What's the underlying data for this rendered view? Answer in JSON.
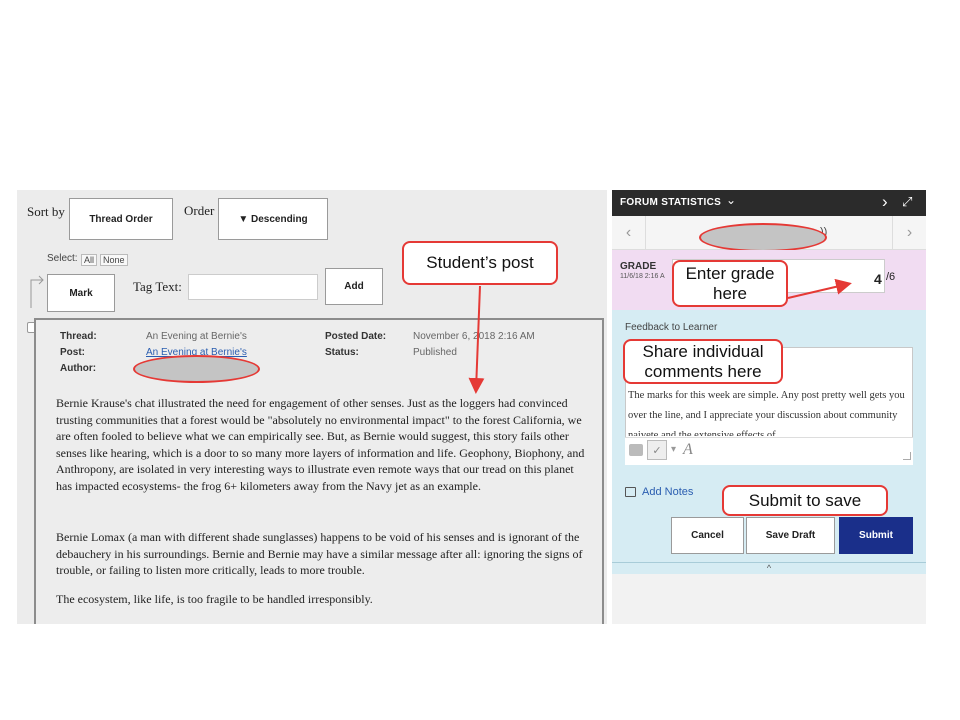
{
  "sort": {
    "sort_by_label": "Sort by",
    "sort_value": "Thread Order",
    "order_label": "Order",
    "order_value": "▼ Descending"
  },
  "select": {
    "label": "Select:",
    "all": "All",
    "none": "None"
  },
  "tagging": {
    "mark_button": "Mark",
    "tag_text_label": "Tag Text:",
    "tag_text_value": "",
    "add_button": "Add"
  },
  "post": {
    "thread_label": "Thread:",
    "thread_value": "An Evening at Bernie's",
    "post_label": "Post:",
    "post_value": "An Evening at Bernie's",
    "author_label": "Author:",
    "posted_date_label": "Posted Date:",
    "posted_date_value": "November 6, 2018 2:16 AM",
    "status_label": "Status:",
    "status_value": "Published",
    "paragraphs": [
      "Bernie Krause's chat illustrated the need for engagement of other senses.  Just as the loggers had convinced trusting communities that a forest would be \"absolutely no environmental impact\" to the forest California, we are often fooled to believe what we can empirically see.  But, as Bernie would suggest, this story fails other senses like hearing, which is a door to so many more layers of information and life.  Geophony, Biophony, and Anthropony, are isolated in very interesting ways to illustrate even remote ways that our tread on this planet has impacted ecosystems- the frog 6+ kilometers away from the Navy jet as an example.",
      "Bernie Lomax (a man with different shade sunglasses) happens to be void of his senses and is ignorant of the debauchery in his surroundings.  Bernie and Bernie may have a similar message after all: ignoring the signs of trouble, or failing to listen more critically, leads to more trouble.",
      "The ecosystem, like life, is too fragile to be handled irresponsibly."
    ]
  },
  "panel": {
    "title": "FORUM STATISTICS",
    "title_caret": "⌄",
    "next_arrow": "›",
    "expand_icon": "⤢",
    "nav_prev": "‹",
    "nav_next": "›",
    "nav_suffix": "))",
    "grade_label": "GRADE",
    "grade_time": "11/6/18 2:16 A",
    "grade_value": "4",
    "grade_max": "/6",
    "feedback_label": "Feedback to Learner",
    "feedback_text": "The marks for this week are simple. Any post pretty well gets you over the line, and I appreciate your discussion about community naivete and the extensive effects of",
    "add_notes": "Add Notes",
    "cancel": "Cancel",
    "save_draft": "Save Draft",
    "submit": "Submit",
    "collapse": "^"
  },
  "annotations": {
    "students_post": "Student’s post",
    "enter_grade": "Enter grade here",
    "share_comments": "Share individual comments here",
    "submit_to_save": "Submit to save"
  },
  "colors": {
    "annotation_red": "#e53935",
    "submit_blue": "#1a2f8a",
    "grade_bg": "#f1dcf2",
    "feedback_bg": "#d6ecf3",
    "header_dark": "#2b2b2b"
  }
}
